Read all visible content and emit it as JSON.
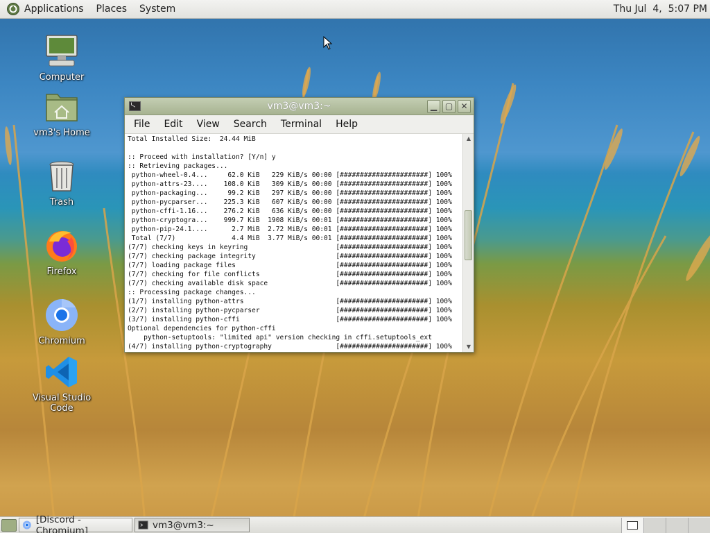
{
  "top_panel": {
    "menus": [
      "Applications",
      "Places",
      "System"
    ],
    "clock": "Thu Jul  4,  5:07 PM"
  },
  "desktop_icons": [
    {
      "label": "Computer",
      "icon": "computer-icon"
    },
    {
      "label": "vm3's Home",
      "icon": "home-folder-icon"
    },
    {
      "label": "Trash",
      "icon": "trash-icon"
    },
    {
      "label": "Firefox",
      "icon": "firefox-icon"
    },
    {
      "label": "Chromium",
      "icon": "chromium-icon"
    },
    {
      "label": "Visual Studio Code",
      "icon": "vscode-icon"
    }
  ],
  "terminal": {
    "title": "vm3@vm3:~",
    "menu": [
      "File",
      "Edit",
      "View",
      "Search",
      "Terminal",
      "Help"
    ],
    "lines": [
      "Total Installed Size:  24.44 MiB",
      "",
      ":: Proceed with installation? [Y/n] y",
      ":: Retrieving packages...",
      " python-wheel-0.4...     62.0 KiB   229 KiB/s 00:00 [######################] 100%",
      " python-attrs-23....    108.0 KiB   309 KiB/s 00:00 [######################] 100%",
      " python-packaging...     99.2 KiB   297 KiB/s 00:00 [######################] 100%",
      " python-pycparser...    225.3 KiB   607 KiB/s 00:00 [######################] 100%",
      " python-cffi-1.16...    276.2 KiB   636 KiB/s 00:00 [######################] 100%",
      " python-cryptogra...    999.7 KiB  1908 KiB/s 00:01 [######################] 100%",
      " python-pip-24.1....      2.7 MiB  2.72 MiB/s 00:01 [######################] 100%",
      " Total (7/7)              4.4 MiB  3.77 MiB/s 00:01 [######################] 100%",
      "(7/7) checking keys in keyring                      [######################] 100%",
      "(7/7) checking package integrity                    [######################] 100%",
      "(7/7) loading package files                         [######################] 100%",
      "(7/7) checking for file conflicts                   [######################] 100%",
      "(7/7) checking available disk space                 [######################] 100%",
      ":: Processing package changes...",
      "(1/7) installing python-attrs                       [######################] 100%",
      "(2/7) installing python-pycparser                   [######################] 100%",
      "(3/7) installing python-cffi                        [######################] 100%",
      "Optional dependencies for python-cffi",
      "    python-setuptools: \"limited api\" version checking in cffi.setuptools_ext",
      "(4/7) installing python-cryptography                [######################] 100%"
    ],
    "scroll_position": 0.45
  },
  "taskbar": {
    "tasks": [
      {
        "label": "[Discord - Chromium]",
        "icon": "chromium-icon",
        "active": false
      },
      {
        "label": "vm3@vm3:~",
        "icon": "terminal-icon",
        "active": true
      }
    ],
    "workspaces": 4,
    "active_workspace": 1
  },
  "colors": {
    "titlebar": "#aab595",
    "panel": "#e6e6e2",
    "terminal_bg": "#ffffff"
  }
}
